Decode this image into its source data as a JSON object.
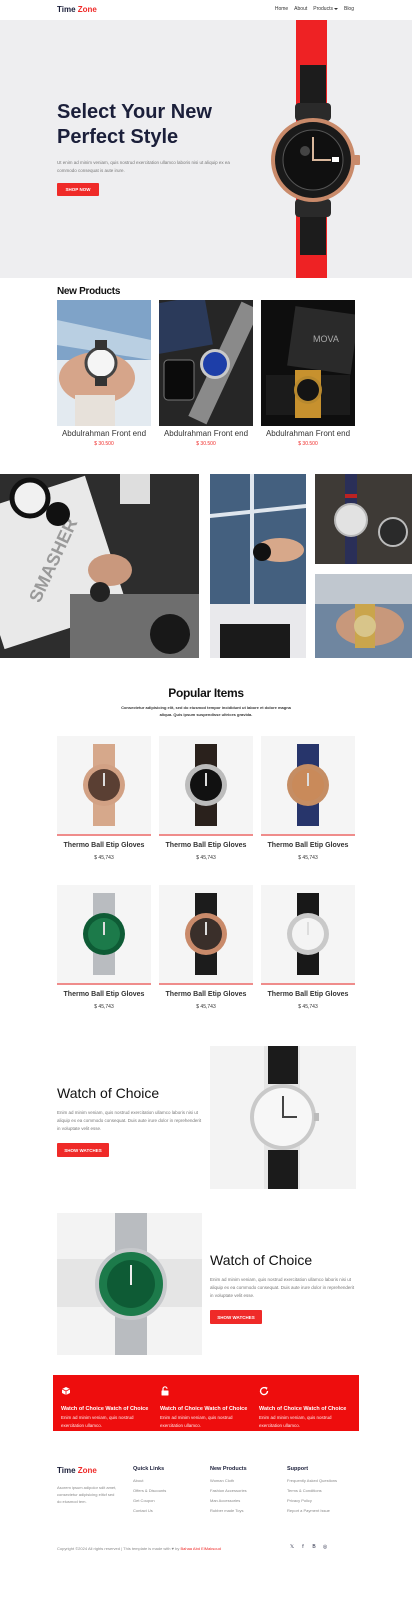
{
  "nav": {
    "logo_primary": "Time",
    "logo_accent": "Zone",
    "links": [
      "Home",
      "About",
      "Products",
      "Blog"
    ]
  },
  "hero": {
    "title_line1": "Select Your New",
    "title_line2": "Perfect Style",
    "subtitle": "Ut enim ad minim veniam, quis nostrud exercitation ullamco laboris nisi ut aliquip ex ea commodo consequat is aute irure.",
    "button": "Shop Now"
  },
  "new_products": {
    "title": "New Products",
    "items": [
      {
        "name": "Abdulrahman Front end",
        "price": "$ 30.500"
      },
      {
        "name": "Abdulrahman Front end",
        "price": "$ 30.500"
      },
      {
        "name": "Abdulrahman Front end",
        "price": "$ 30.500"
      }
    ]
  },
  "popular": {
    "title": "Popular Items",
    "subtitle": "Consectetur adipisicing elit, sed do eiusmod tempor incididunt ut labore et dolore magna aliqua. Quis ipsum suspendisse ultrices gravida.",
    "items": [
      {
        "name": "Thermo Ball Etip Gloves",
        "price": "$ 45,743"
      },
      {
        "name": "Thermo Ball Etip Gloves",
        "price": "$ 45,743"
      },
      {
        "name": "Thermo Ball Etip Gloves",
        "price": "$ 45,743"
      },
      {
        "name": "Thermo Ball Etip Gloves",
        "price": "$ 45,743"
      },
      {
        "name": "Thermo Ball Etip Gloves",
        "price": "$ 45,743"
      },
      {
        "name": "Thermo Ball Etip Gloves",
        "price": "$ 45,743"
      }
    ]
  },
  "choice1": {
    "title": "Watch of Choice",
    "text": "Enim ad minim veniam, quis nostrud exercitation ullamco laboris nisi ut aliquip ex ea commodo consequat. Duis aute irure dolor in reprehenderit in voluptate velit esse.",
    "button": "Show Watches"
  },
  "choice2": {
    "title": "Watch of Choice",
    "text": "Enim ad minim veniam, quis nostrud exercitation ullamco laboris nisi ut aliquip ex ea commodo consequat. Duis aute irure dolor in reprehenderit in voluptate velit esse.",
    "button": "Show Watches"
  },
  "features": [
    {
      "icon": "package-icon",
      "title": "Watch of Choice Watch of Choice",
      "text": "Enim ad minim veniam, quis nostrud exercitation ullamco."
    },
    {
      "icon": "unlock-icon",
      "title": "Watch of Choice Watch of Choice",
      "text": "Enim ad minim veniam, quis nostrud exercitation ullamco."
    },
    {
      "icon": "refresh-icon",
      "title": "Watch of Choice Watch of Choice",
      "text": "Enim ad minim veniam, quis nostrud exercitation ullamco."
    }
  ],
  "footer": {
    "logo_primary": "Time",
    "logo_accent": "Zone",
    "about": "Asorem ipsum adipolor sdit amet, consectetur adipisicing elitcf sed do eiusmod tem.",
    "columns": [
      {
        "title": "Quick Links",
        "links": [
          "About",
          "Offers & Discounts",
          "Get Coupon",
          "Contact Us"
        ]
      },
      {
        "title": "New Products",
        "links": [
          "Woman Cloth",
          "Fashion Accessories",
          "Man Accessories",
          "Rubber made Toys"
        ]
      },
      {
        "title": "Support",
        "links": [
          "Frequently Asked Questions",
          "Terms & Conditions",
          "Privacy Policy",
          "Report a Payment Issue"
        ]
      }
    ],
    "copyright_prefix": "Copyright ©2024 All rights reserved | This template is made with ♥ by ",
    "copyright_author": "Bahaa Abd ElMaksoud",
    "social": [
      "twitter-icon",
      "facebook-icon",
      "behance-icon",
      "globe-icon"
    ]
  },
  "colors": {
    "accent": "#ef2a28",
    "navy": "#1b1f3a",
    "band": "#ee0d0d"
  }
}
